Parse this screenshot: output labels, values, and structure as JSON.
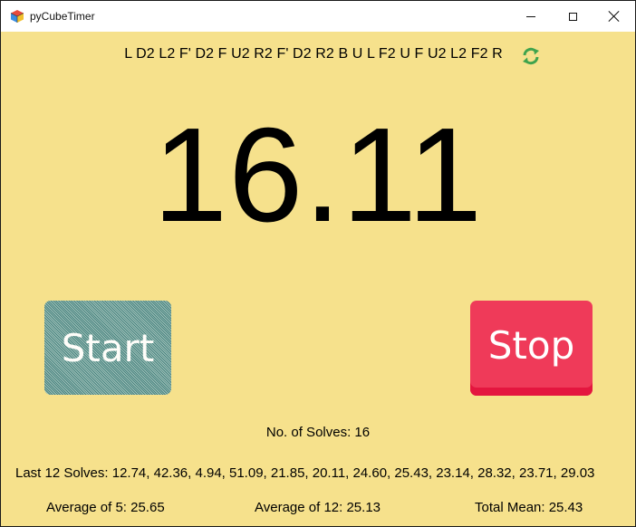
{
  "window": {
    "title": "pyCubeTimer",
    "icon": "rubiks-cube-icon",
    "controls": {
      "minimize": "minimize-icon",
      "maximize": "maximize-icon",
      "close": "close-icon"
    }
  },
  "scramble": {
    "text": "L D2 L2 F' D2 F U2 R2 F' D2 R2 B U L F2 U F U2 L2 F2 R",
    "refresh_icon": "refresh-icon"
  },
  "timer": {
    "display": "16.11"
  },
  "buttons": {
    "start_label": "Start",
    "stop_label": "Stop"
  },
  "stats": {
    "solves_count_text": "No. of Solves: 16",
    "last_solves_text": "Last 12 Solves: 12.74, 42.36, 4.94, 51.09, 21.85, 20.11, 24.60, 25.43, 23.14, 28.32, 23.71, 29.03",
    "avg5_text": "Average of 5: 25.65",
    "avg12_text": "Average of 12: 25.13",
    "total_mean_text": "Total Mean: 25.43"
  },
  "colors": {
    "background": "#f6e18c",
    "stop_button": "#ef3a59",
    "start_button": "#6a9ea0"
  }
}
